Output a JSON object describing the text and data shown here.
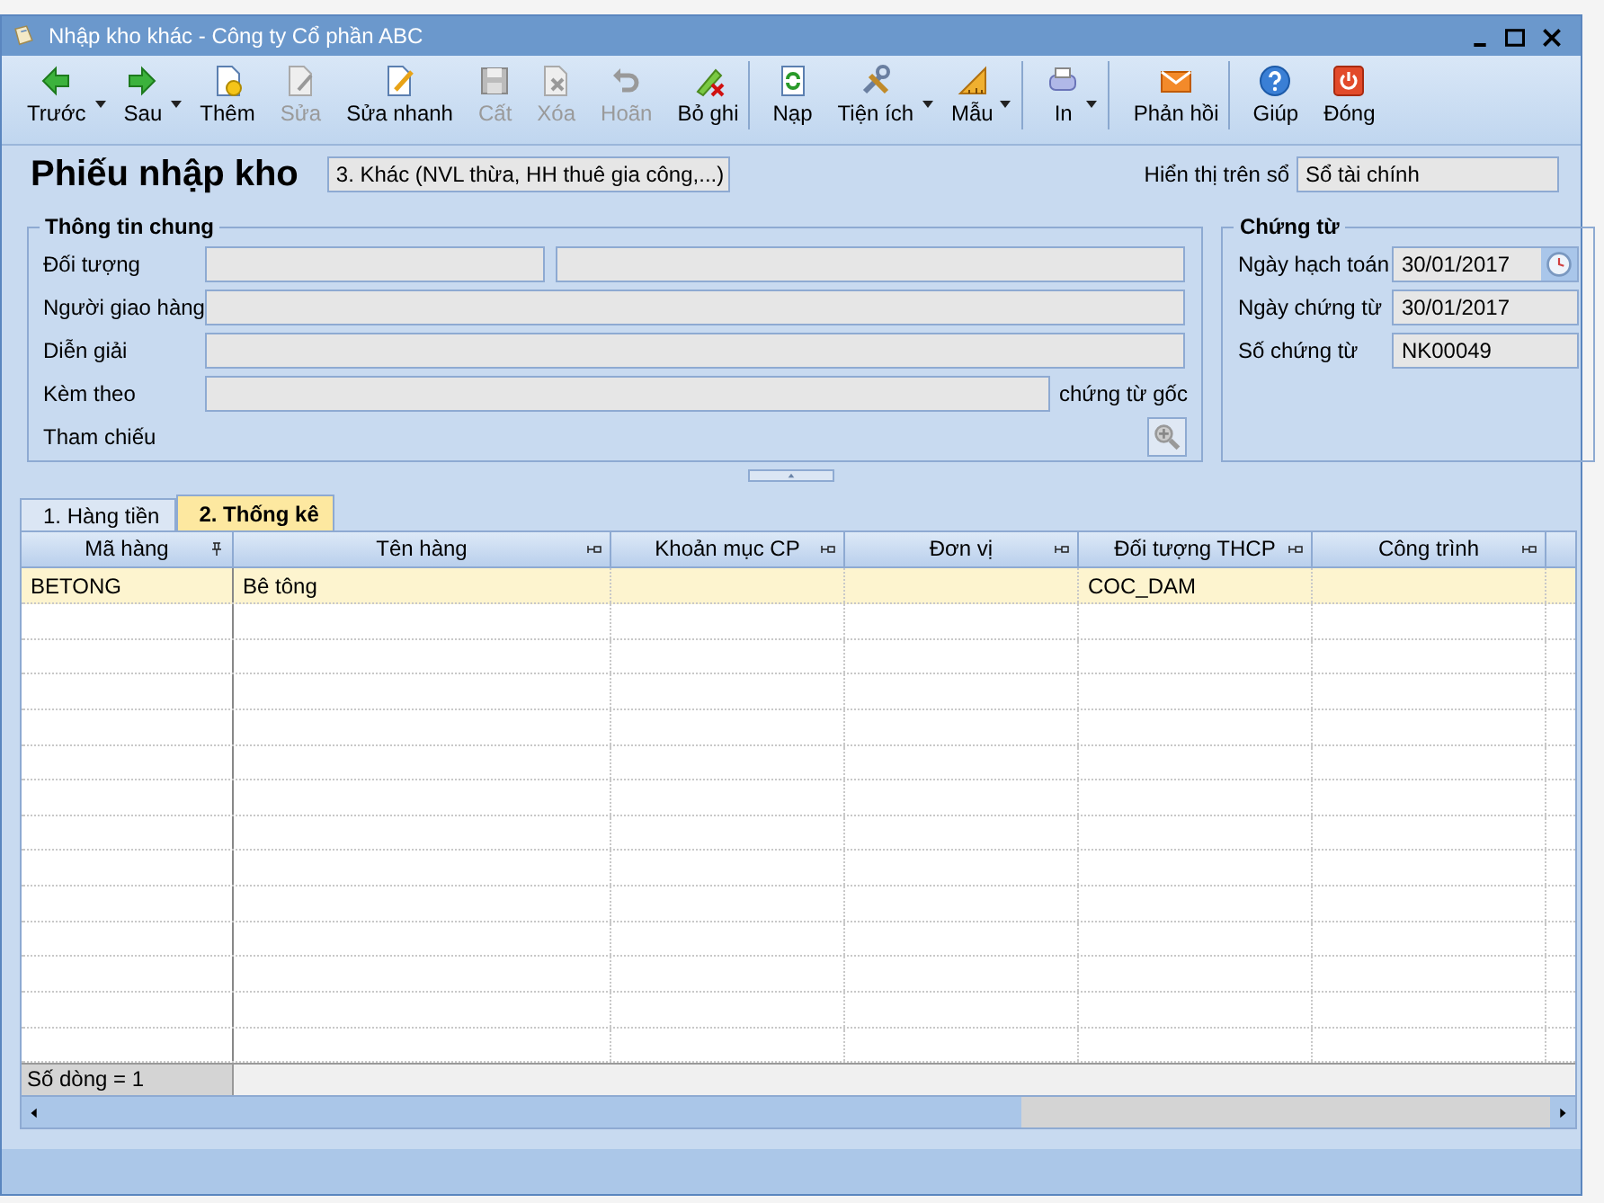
{
  "window": {
    "title": "Nhập kho khác - Công ty Cổ phần ABC"
  },
  "toolbar": [
    {
      "label": "Trước",
      "kind": "back",
      "disabled": false,
      "dropdown": true,
      "separator_after": false
    },
    {
      "label": "Sau",
      "kind": "forward",
      "disabled": false,
      "dropdown": true,
      "separator_after": false
    },
    {
      "label": "Thêm",
      "kind": "add",
      "disabled": false,
      "dropdown": false,
      "separator_after": false
    },
    {
      "label": "Sửa",
      "kind": "edit",
      "disabled": true,
      "dropdown": false,
      "separator_after": false
    },
    {
      "label": "Sửa nhanh",
      "kind": "quickedit",
      "disabled": false,
      "dropdown": false,
      "separator_after": false
    },
    {
      "label": "Cất",
      "kind": "save",
      "disabled": true,
      "dropdown": false,
      "separator_after": false
    },
    {
      "label": "Xóa",
      "kind": "delete",
      "disabled": true,
      "dropdown": false,
      "separator_after": false
    },
    {
      "label": "Hoãn",
      "kind": "undo",
      "disabled": true,
      "dropdown": false,
      "separator_after": false
    },
    {
      "label": "Bỏ ghi",
      "kind": "unpost",
      "disabled": false,
      "dropdown": false,
      "separator_after": true
    },
    {
      "label": "Nạp",
      "kind": "reload",
      "disabled": false,
      "dropdown": false,
      "separator_after": false
    },
    {
      "label": "Tiện ích",
      "kind": "tools",
      "disabled": false,
      "dropdown": true,
      "separator_after": false
    },
    {
      "label": "Mẫu",
      "kind": "ruler",
      "disabled": false,
      "dropdown": true,
      "separator_after": true
    },
    {
      "label": "In",
      "kind": "print",
      "disabled": false,
      "dropdown": true,
      "separator_after": true
    },
    {
      "label": "Phản hồi",
      "kind": "mail",
      "disabled": false,
      "dropdown": false,
      "separator_after": true
    },
    {
      "label": "Giúp",
      "kind": "help",
      "disabled": false,
      "dropdown": false,
      "separator_after": false
    },
    {
      "label": "Đóng",
      "kind": "power",
      "disabled": false,
      "dropdown": false,
      "separator_after": false
    }
  ],
  "voucher": {
    "title": "Phiếu nhập kho",
    "type": "3. Khác (NVL thừa, HH thuê gia công,...)",
    "book_label": "Hiển thị trên sổ",
    "book": "Sổ tài chính"
  },
  "general_info": {
    "title": "Thông tin chung",
    "fields": [
      {
        "label": "Đối tượng",
        "kind": "double"
      },
      {
        "label": "Người giao hàng",
        "kind": "single"
      },
      {
        "label": "Diễn giải",
        "kind": "single"
      },
      {
        "label": "Kèm theo",
        "kind": "attach",
        "suffix": "chứng từ gốc"
      },
      {
        "label": "Tham chiếu",
        "kind": "reference"
      }
    ]
  },
  "document": {
    "title": "Chứng từ",
    "fields": [
      {
        "label": "Ngày hạch toán",
        "value": "30/01/2017",
        "kind": "date"
      },
      {
        "label": "Ngày chứng từ",
        "value": "30/01/2017",
        "kind": "text"
      },
      {
        "label": "Số chứng từ",
        "value": "NK00049",
        "kind": "text"
      }
    ]
  },
  "tabs": [
    {
      "label": "1. Hàng tiền",
      "selected": false
    },
    {
      "label": "2. Thống kê",
      "selected": true
    }
  ],
  "table": {
    "columns": [
      {
        "label": "Mã hàng",
        "pinned": true
      },
      {
        "label": "Tên hàng",
        "pinned": false
      },
      {
        "label": "Khoản mục CP",
        "pinned": false
      },
      {
        "label": "Đơn vị",
        "pinned": false
      },
      {
        "label": "Đối tượng THCP",
        "pinned": false
      },
      {
        "label": "Công trình",
        "pinned": false
      }
    ],
    "rows": [
      {
        "cells": [
          "BETONG",
          "Bê tông",
          null,
          null,
          "COC_DAM",
          null
        ],
        "selected": true
      }
    ],
    "footer": "Số dòng = 1"
  }
}
